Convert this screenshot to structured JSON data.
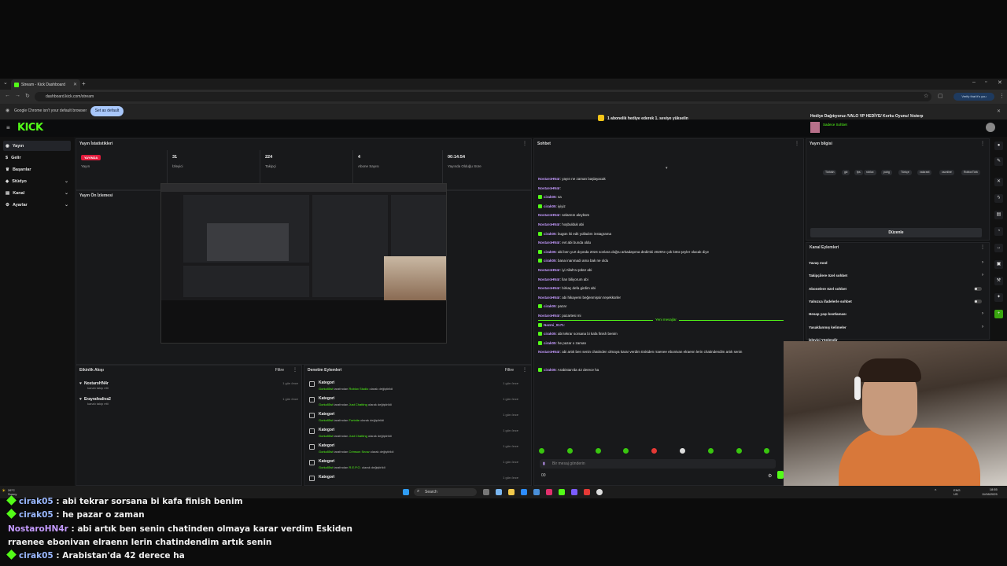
{
  "browser": {
    "tab_title": "Stream - Kick Dashboard",
    "url": "dashboard.kick.com/stream",
    "verify_label": "Verify that it's you",
    "infobar_text": "Google Chrome isn't your default browser",
    "infobar_button": "Set as default"
  },
  "kick": {
    "logo": "KICK",
    "sidebar": [
      {
        "label": "Yayın",
        "icon": "broadcast-icon"
      },
      {
        "label": "Gelir",
        "icon": "dollar-icon"
      },
      {
        "label": "Başarılar",
        "icon": "trophy-icon"
      },
      {
        "label": "Stüdyo",
        "icon": "studio-icon"
      },
      {
        "label": "Kanal",
        "icon": "channel-icon"
      },
      {
        "label": "Ayarlar",
        "icon": "settings-icon"
      }
    ],
    "stats": {
      "title": "Yayın İstatistikleri",
      "live_badge": "YAYINDA",
      "live_label": "Yayın",
      "viewers_value": "31",
      "viewers_label": "İzleyici",
      "followers_value": "224",
      "followers_label": "Takipçi",
      "subs_value": "4",
      "subs_label": "Abone Sayısı",
      "duration_value": "00:14:54",
      "duration_label": "Yayında Olduğu Süre"
    },
    "preview_title": "Yayın Ön İzlemesi",
    "activity": {
      "title": "Etkinlik Akışı",
      "filter": "Filtre",
      "items": [
        {
          "name": "NostaroHN4r",
          "sub": "kanalı takip etti",
          "time": "1 gün önce"
        },
        {
          "name": "Erayrafealiva2",
          "sub": "kanalı takip etti",
          "time": "1 gün önce"
        }
      ]
    },
    "moderation": {
      "title": "Denetim Eylemleri",
      "filter": "Filtre",
      "items": [
        {
          "kind": "Kategori",
          "user": "Gorkz85st",
          "mid": " tarafından ",
          "val": "Roblox Studio",
          "end": " olarak değiştirildi",
          "time": "1 gün önce"
        },
        {
          "kind": "Kategori",
          "user": "Gorkz85st",
          "mid": " tarafından ",
          "val": "Just Chatting",
          "end": " olarak değiştirildi",
          "time": "1 gün önce"
        },
        {
          "kind": "Kategori",
          "user": "Gorkz85st",
          "mid": " tarafından ",
          "val": "Fortnite",
          "end": " olarak değiştirildi",
          "time": "1 gün önce"
        },
        {
          "kind": "Kategori",
          "user": "Gorkz85st",
          "mid": " tarafından ",
          "val": "Just Chatting",
          "end": " olarak değiştirildi",
          "time": "1 gün önce"
        },
        {
          "kind": "Kategori",
          "user": "Gorkz85st",
          "mid": " tarafından ",
          "val": "Crimson Snow",
          "end": " olarak değiştirildi",
          "time": "1 gün önce"
        },
        {
          "kind": "Kategori",
          "user": "Gorkz85st",
          "mid": " tarafından ",
          "val": "R.E.P.O.",
          "end": " olarak değiştirildi",
          "time": "1 gün önce"
        },
        {
          "kind": "Kategori",
          "user": "",
          "mid": "",
          "val": "",
          "end": "",
          "time": "1 gün önce"
        }
      ]
    },
    "chat": {
      "title": "Sohbet",
      "pinned": "1 abonelik hediye ederek 1. seviye yükselin",
      "new_messages": "Yeni mesajlar",
      "input_placeholder": "Bir mesaj gönderin",
      "count": "00",
      "messages": [
        {
          "user": "NostaroHN4r",
          "color": "purple",
          "badge": false,
          "text": ": yayın ne zaman başlayacak"
        },
        {
          "user": "NostaroHN4r",
          "color": "purple",
          "badge": false,
          "text": ":"
        },
        {
          "user": "cirak05",
          "color": "purple",
          "badge": true,
          "text": ": sa"
        },
        {
          "user": "cirak05",
          "color": "purple",
          "badge": true,
          "text": ": iyiyiz"
        },
        {
          "user": "NostaroHN4r",
          "color": "purple",
          "badge": false,
          "text": ": selamün aleyküm"
        },
        {
          "user": "NostaroHN4r",
          "color": "purple",
          "badge": false,
          "text": ": hoşbulduk abi"
        },
        {
          "user": "cirak05",
          "color": "purple",
          "badge": true,
          "text": ": bugün iki edit yolladım instagrama"
        },
        {
          "user": "NostaroHN4r",
          "color": "purple",
          "badge": false,
          "text": ": evt abi bunda oldu"
        },
        {
          "user": "cirak05",
          "color": "purple",
          "badge": true,
          "text": ": abi ben yurt dışında 2024 sonlara doğru arkadaşıma dedimki 2025'te çok kötü şeyler olacak diye"
        },
        {
          "user": "cirak05",
          "color": "purple",
          "badge": true,
          "text": ": bana inanmadı ama bak ne oldu"
        },
        {
          "user": "NostaroHN4r",
          "color": "purple",
          "badge": false,
          "text": ": iyi Allah'a şükür abi"
        },
        {
          "user": "NostaroHN4r",
          "color": "purple",
          "badge": false,
          "text": ": llan biliyorum abi"
        },
        {
          "user": "NostaroHN4r",
          "color": "purple",
          "badge": false,
          "text": ": birkaç defa girdim abi"
        },
        {
          "user": "NostaroHN4r",
          "color": "purple",
          "badge": false,
          "text": ": abi hikayemi beğenmişsin teşekkürler"
        },
        {
          "user": "cirak05",
          "color": "purple",
          "badge": true,
          "text": ": pazar"
        },
        {
          "user": "NostaroHN4r",
          "color": "purple",
          "badge": false,
          "text": ": pazartesi mi"
        },
        {
          "user": "Nazmi_0171",
          "color": "purple",
          "badge": true,
          "text": ":"
        },
        {
          "user": "cirak05",
          "color": "purple",
          "badge": true,
          "text": ": abi tekrar sorsana bi kafa finish benim"
        },
        {
          "user": "cirak05",
          "color": "purple",
          "badge": true,
          "text": ": he pazar o zaman"
        },
        {
          "user": "NostaroHN4r",
          "color": "purple",
          "badge": false,
          "text": ": abi artık ben senin chatinden olmaya karar verdim Eskiden rraenee ebonivan elraenn lerin chatindendim artık senin"
        }
      ],
      "after_new": {
        "user": "cirak05",
        "text": ": Arabistan'da 42 derece ha"
      }
    },
    "stream_info": {
      "title": "Yayın bilgisi",
      "stream_title": "Hediye Dağıtıyoruz /VALO VP HEDİYE/ Korku Oyunu/ !tisterp",
      "category": "Sadece Sohbet",
      "tags": [
        "Türkish",
        "glz",
        "fps",
        "roblox",
        "pubg",
        "Türkçe",
        "valorant",
        "csonline",
        "RobloxTürk"
      ],
      "edit_button": "Düzenle"
    },
    "channel_actions": {
      "title": "Kanal Eylemleri",
      "rows": [
        {
          "label": "Yavaş mod",
          "kind": "arrow"
        },
        {
          "label": "Takipçilere özel sohbet",
          "kind": "arrow"
        },
        {
          "label": "Abonelere özel sohbet",
          "kind": "toggle"
        },
        {
          "label": "Yalnızca ifadelerle sohbet",
          "kind": "toggle"
        },
        {
          "label": "Hesap yaşı kısıtlaması",
          "kind": "arrow"
        },
        {
          "label": "Yasaklanmış kelimeler",
          "kind": "arrow"
        },
        {
          "label": "İzleyici Yönlendir",
          "kind": "none"
        }
      ]
    }
  },
  "taskbar": {
    "weather_temp": "26°C",
    "weather_desc": "Sunny",
    "search_placeholder": "Search",
    "lang_top": "ENG",
    "lang_bottom": "US",
    "time": "18:55",
    "date": "11/08/2025"
  },
  "overlay_chat": [
    {
      "user": "cirak05",
      "text": " : abi tekrar sorsana bi kafa finish benim",
      "badge": true
    },
    {
      "user": "cirak05",
      "text": " : he pazar o zaman",
      "badge": true
    },
    {
      "user": "NostaroHN4r",
      "text": " : abi artık ben senin chatinden olmaya karar verdim Eskiden",
      "badge": false
    },
    {
      "user": "",
      "text": "rraenee ebonivan elraenn lerin chatindendim artık senin",
      "badge": false
    },
    {
      "user": "cirak05",
      "text": " : Arabistan'da 42 derece ha",
      "badge": true
    }
  ],
  "colors": {
    "kick_green": "#53fc18",
    "live_red": "#e11b3c",
    "username_purple": "#c59bff"
  }
}
